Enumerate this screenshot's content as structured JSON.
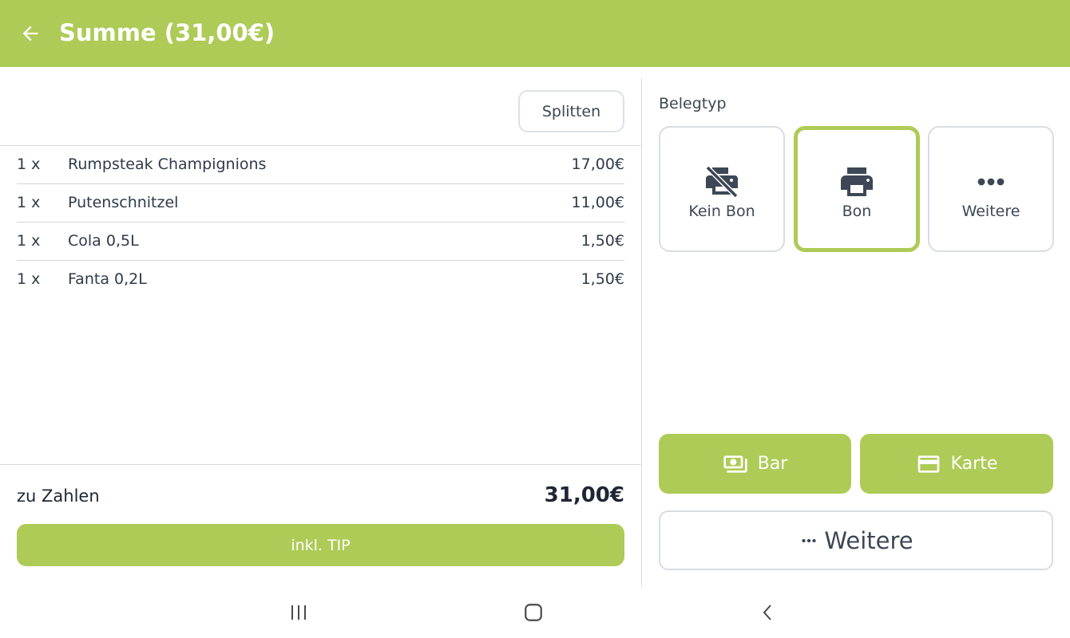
{
  "appbar": {
    "title": "Summe (31,00€)",
    "icon": "arrow-back-icon",
    "color": "#adcb56"
  },
  "order": {
    "split_label": "Splitten",
    "items": [
      {
        "qty": "1 x",
        "name": "Rumpsteak Champignions",
        "price": "17,00€"
      },
      {
        "qty": "1 x",
        "name": "Putenschnitzel",
        "price": "11,00€"
      },
      {
        "qty": "1 x",
        "name": "Cola 0,5L",
        "price": "1,50€"
      },
      {
        "qty": "1 x",
        "name": "Fanta 0,2L",
        "price": "1,50€"
      }
    ],
    "due_label": "zu Zahlen",
    "due_amount": "31,00€",
    "tip_label": "inkl. TIP"
  },
  "receipt": {
    "label": "Belegtyp",
    "options": [
      {
        "label": "Kein Bon",
        "icon": "print-disabled-icon",
        "selected": false
      },
      {
        "label": "Bon",
        "icon": "printer-icon",
        "selected": true
      },
      {
        "label": "Weitere",
        "icon": "more-horiz-icon",
        "selected": false
      }
    ]
  },
  "payment": {
    "cash_label": "Bar",
    "cash_icon": "cash-icon",
    "card_label": "Karte",
    "card_icon": "credit-card-icon",
    "more_label": "Weitere",
    "more_icon": "more-horiz-icon"
  },
  "navbar": {
    "icons": [
      "recent-apps-icon",
      "home-icon",
      "back-icon"
    ]
  }
}
